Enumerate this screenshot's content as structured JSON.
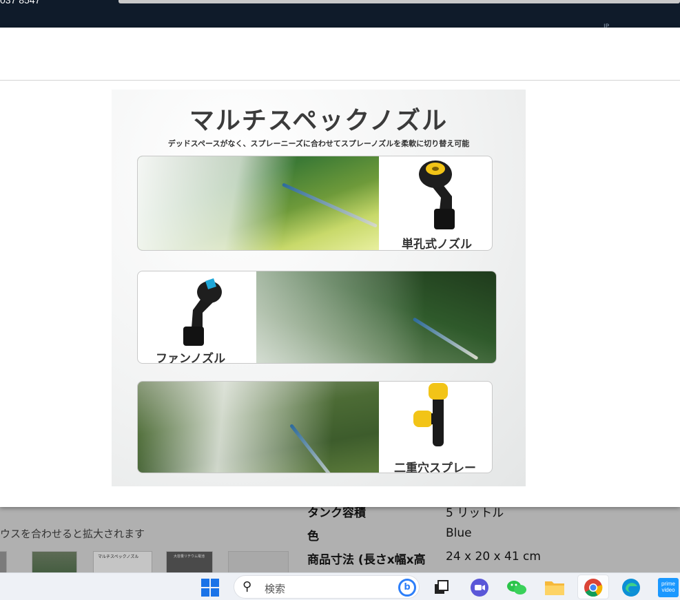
{
  "header": {
    "cut_text": "037 8547",
    "corner_text": "IP"
  },
  "product_image": {
    "title": "マルチスペックノズル",
    "subtitle": "デッドスペースがなく、スプレーニーズに合わせてスプレーノズルを柔軟に切り替え可能",
    "nozzles": [
      {
        "label": "単孔式ノズル",
        "color": "#f2c417"
      },
      {
        "label": "ファンノズル",
        "color": "#1fa7d8"
      },
      {
        "label": "二重穴スプレー",
        "color": "#f2c417"
      }
    ]
  },
  "background_page": {
    "zoom_hint": "ウスを合わせると拡大されます",
    "thumbnails": [
      {
        "caption": ""
      },
      {
        "caption": ""
      },
      {
        "caption": "マルチスペックノズル"
      },
      {
        "caption": "大容量リチウム電池"
      },
      {
        "caption": ""
      }
    ],
    "specs": [
      {
        "key": "タンク容積",
        "value": "5 リットル"
      },
      {
        "key": "色",
        "value": "Blue"
      },
      {
        "key": "商品寸法 (長さx幅x高",
        "value": "24 x 20 x 41 cm"
      }
    ]
  },
  "taskbar": {
    "search_placeholder": "検索",
    "apps": [
      "windows-start",
      "search",
      "bing",
      "task-view",
      "zoom",
      "wechat",
      "file-explorer",
      "chrome",
      "edge",
      "prime-video"
    ],
    "prime_label_1": "prime",
    "prime_label_2": "video"
  }
}
